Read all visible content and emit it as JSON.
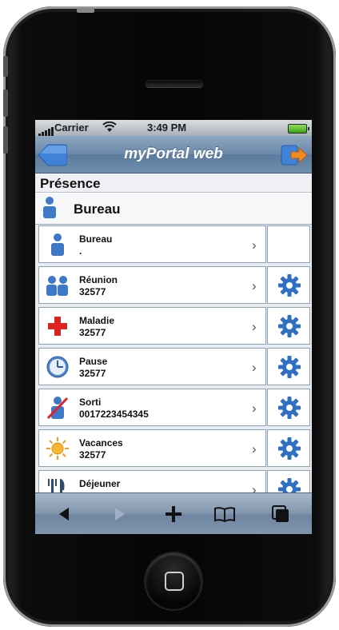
{
  "status_bar": {
    "carrier": "Carrier",
    "time": "3:49 PM"
  },
  "nav": {
    "title": "myPortal web"
  },
  "section": {
    "title": "Présence"
  },
  "current": {
    "label": "Bureau"
  },
  "items": [
    {
      "name": "Bureau",
      "number": ".",
      "icon": "person-office-icon",
      "has_gear": false
    },
    {
      "name": "Réunion",
      "number": "32577",
      "icon": "meeting-people-icon",
      "has_gear": true
    },
    {
      "name": "Maladie",
      "number": "32577",
      "icon": "red-cross-icon",
      "has_gear": true
    },
    {
      "name": "Pause",
      "number": "32577",
      "icon": "clock-icon",
      "has_gear": true
    },
    {
      "name": "Sorti",
      "number": "0017223454345",
      "icon": "person-out-icon",
      "has_gear": true
    },
    {
      "name": "Vacances",
      "number": "32577",
      "icon": "sun-icon",
      "has_gear": true
    },
    {
      "name": "Déjeuner",
      "number": "",
      "icon": "cutlery-icon",
      "has_gear": true
    }
  ],
  "toolbar": [
    "back-arrow-icon",
    "forward-arrow-icon",
    "add-icon",
    "bookmarks-icon",
    "pages-icon"
  ],
  "colors": {
    "navbar": "#6a88a8",
    "accent_orange": "#f08a24",
    "gear_blue": "#2f6fc4"
  }
}
